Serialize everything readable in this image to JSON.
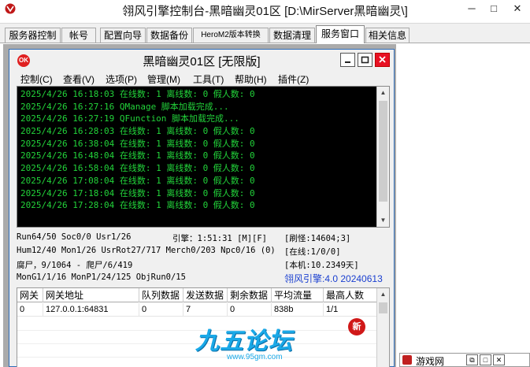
{
  "window": {
    "title": "翎风引擎控制台-黑暗幽灵01区 [D:\\MirServer黑暗幽灵\\]",
    "minimize_glyph": "─",
    "maximize_glyph": "□",
    "close_glyph": "✕"
  },
  "tabs": [
    {
      "label": "服务器控制"
    },
    {
      "label": "帐号"
    },
    {
      "label": "配置向导"
    },
    {
      "label": "数据备份"
    },
    {
      "label": "HeroM2版本转换"
    },
    {
      "label": "数据清理"
    },
    {
      "label": "服务窗口",
      "active": true
    },
    {
      "label": "相关信息"
    }
  ],
  "inner_window": {
    "icon_label": "OK",
    "title": "黑暗幽灵01区 [无限版]",
    "menu": [
      "控制(C)",
      "查看(V)",
      "选项(P)",
      "管理(M)",
      "工具(T)",
      "帮助(H)",
      "插件(Z)"
    ]
  },
  "log": {
    "lines": [
      "2025/4/26 16:18:03 在线数: 1 离线数: 0 假人数: 0",
      "2025/4/26 16:27:16 QManage 脚本加载完成...",
      "2025/4/26 16:27:19 QFunction 脚本加载完成...",
      "2025/4/26 16:28:03 在线数: 1 离线数: 0 假人数: 0",
      "2025/4/26 16:38:04 在线数: 1 离线数: 0 假人数: 0",
      "2025/4/26 16:48:04 在线数: 1 离线数: 0 假人数: 0",
      "2025/4/26 16:58:04 在线数: 1 离线数: 0 假人数: 0",
      "2025/4/26 17:08:04 在线数: 1 离线数: 0 假人数: 0",
      "2025/4/26 17:18:04 在线数: 1 离线数: 0 假人数: 0",
      "2025/4/26 17:28:04 在线数: 1 离线数: 0 假人数: 0"
    ]
  },
  "status": {
    "run": "Run64/50 Soc0/0 Usr1/26",
    "engine": "引擎：1:51:31 [M][F]",
    "refresh": "[刷怪:14604;3]",
    "hum": "Hum12/40 Mon1/26 UsrRot27/717 Merch0/203 Npc0/16 (0)",
    "online": "[在线:1/0/0]",
    "decay": "腐尸，9/1064 - 爬尸/6/419",
    "uptime": "[本机:10.2349天]",
    "mongen": "MonG1/1/16 MonP1/24/125 ObjRun0/15",
    "version": "翎风引擎:4.0 20240613"
  },
  "gateway_table": {
    "headers": [
      "网关",
      "网关地址",
      "队列数据",
      "发送数据",
      "剩余数据",
      "平均流量",
      "最高人数"
    ],
    "rows": [
      [
        "0",
        "127.0.0.1:64831",
        "0",
        "7",
        "0",
        "838b",
        "1/1"
      ]
    ]
  },
  "watermark": {
    "text": "九五论坛",
    "url": "www.95gm.com",
    "badge": "新"
  },
  "mini_window": {
    "title": "游戏网",
    "restore_glyph": "⧉",
    "max_glyph": "□",
    "close_glyph": "✕"
  },
  "colors": {
    "log_text": "#22d33a",
    "log_bg": "#000000",
    "close_red": "#e81123",
    "version_blue": "#1a3fd0"
  }
}
